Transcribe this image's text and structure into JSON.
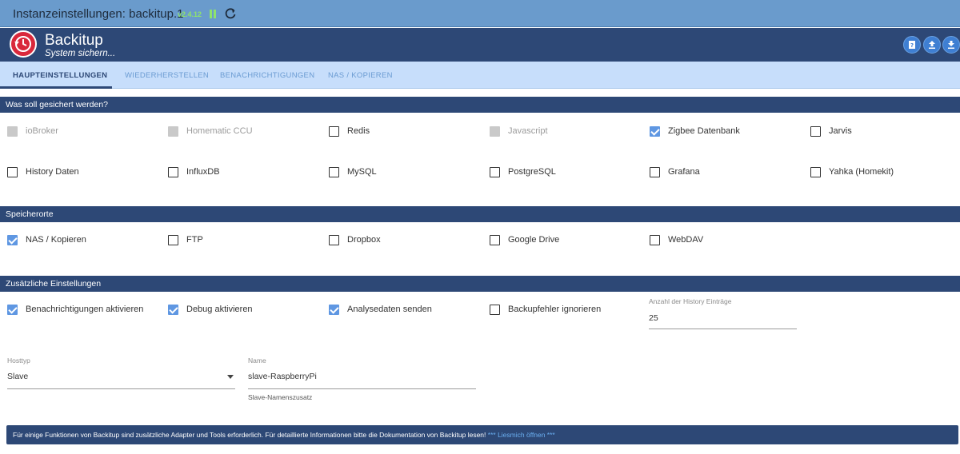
{
  "window": {
    "title": "Instanzeinstellungen: backitup.1",
    "version": "v2.4.12"
  },
  "header": {
    "app_name": "Backitup",
    "subtitle": "System sichern..."
  },
  "tabs": [
    {
      "label": "HAUPTEINSTELLUNGEN",
      "active": true
    },
    {
      "label": "WIEDERHERSTELLEN",
      "active": false
    },
    {
      "label": "BENACHRICHTIGUNGEN",
      "active": false
    },
    {
      "label": "NAS / KOPIEREN",
      "active": false
    }
  ],
  "sections": {
    "backup": "Was soll gesichert werden?",
    "storage": "Speicherorte",
    "extra": "Zusätzliche Einstellungen"
  },
  "backup_items": [
    {
      "label": "ioBroker",
      "state": "disabled"
    },
    {
      "label": "Homematic CCU",
      "state": "disabled"
    },
    {
      "label": "Redis",
      "state": "unchecked"
    },
    {
      "label": "Javascript",
      "state": "disabled"
    },
    {
      "label": "Zigbee Datenbank",
      "state": "checked"
    },
    {
      "label": "Jarvis",
      "state": "unchecked"
    },
    {
      "label": "History Daten",
      "state": "unchecked"
    },
    {
      "label": "InfluxDB",
      "state": "unchecked"
    },
    {
      "label": "MySQL",
      "state": "unchecked"
    },
    {
      "label": "PostgreSQL",
      "state": "unchecked"
    },
    {
      "label": "Grafana",
      "state": "unchecked"
    },
    {
      "label": "Yahka (Homekit)",
      "state": "unchecked"
    }
  ],
  "storage_items": [
    {
      "label": "NAS / Kopieren",
      "state": "checked"
    },
    {
      "label": "FTP",
      "state": "unchecked"
    },
    {
      "label": "Dropbox",
      "state": "unchecked"
    },
    {
      "label": "Google Drive",
      "state": "unchecked"
    },
    {
      "label": "WebDAV",
      "state": "unchecked"
    }
  ],
  "extra_items": [
    {
      "label": "Benachrichtigungen aktivieren",
      "state": "checked"
    },
    {
      "label": "Debug aktivieren",
      "state": "checked"
    },
    {
      "label": "Analysedaten senden",
      "state": "checked"
    },
    {
      "label": "Backupfehler ignorieren",
      "state": "unchecked"
    }
  ],
  "history_count": {
    "label": "Anzahl der History Einträge",
    "value": "25"
  },
  "hosttype": {
    "label": "Hosttyp",
    "value": "Slave"
  },
  "name_field": {
    "label": "Name",
    "value": "slave-RaspberryPi",
    "helper": "Slave-Namenszusatz"
  },
  "info": {
    "text": "Für einige Funktionen von Backitup sind zusätzliche Adapter und Tools erforderlich. Für detaillierte Informationen bitte die Dokumentation von Backitup lesen!",
    "link": "*** Liesmich öffnen ***"
  },
  "colors": {
    "titlebar": "#6a9bcc",
    "header": "#2d4876",
    "tabs_bg": "#c7defb",
    "checkbox_checked": "#5f97e2",
    "logo": "#d9283b",
    "version": "#8fe36c"
  },
  "icons": {
    "logo": "backup-clock-icon",
    "pause": "pause-icon",
    "reload": "reload-icon",
    "help": "help-book-icon",
    "upload": "upload-icon",
    "download": "download-icon"
  }
}
